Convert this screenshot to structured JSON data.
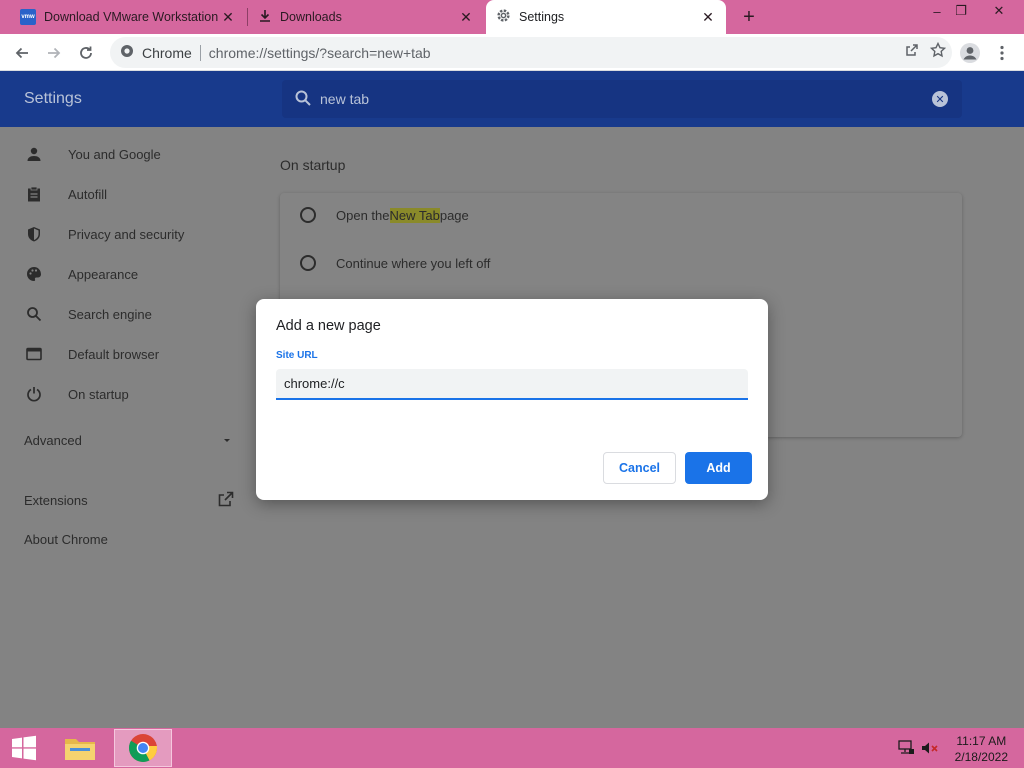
{
  "tabs": [
    {
      "title": "Download VMware Workstation",
      "favicon": "vmware-icon",
      "favicon_text": "vmw"
    },
    {
      "title": "Downloads",
      "favicon": "download-icon"
    },
    {
      "title": "Settings",
      "favicon": "gear-icon",
      "active": true
    }
  ],
  "omnibox": {
    "site": "Chrome",
    "url": "chrome://settings/?search=new+tab"
  },
  "settings": {
    "title": "Settings",
    "search_value": "new tab",
    "nav": [
      {
        "label": "You and Google",
        "icon": "person-icon"
      },
      {
        "label": "Autofill",
        "icon": "clipboard-icon"
      },
      {
        "label": "Privacy and security",
        "icon": "shield-icon"
      },
      {
        "label": "Appearance",
        "icon": "palette-icon"
      },
      {
        "label": "Search engine",
        "icon": "search-icon"
      },
      {
        "label": "Default browser",
        "icon": "browser-icon"
      },
      {
        "label": "On startup",
        "icon": "power-icon"
      }
    ],
    "advanced": "Advanced",
    "extensions": "Extensions",
    "about": "About Chrome",
    "section_title": "On startup",
    "startup_options": {
      "opt1_pre": "Open the ",
      "opt1_hl": "New Tab",
      "opt1_post": " page",
      "opt2": "Continue where you left off"
    }
  },
  "dialog": {
    "title": "Add a new page",
    "field_label": "Site URL",
    "field_value": "chrome://c",
    "cancel": "Cancel",
    "add": "Add"
  },
  "taskbar": {
    "time": "11:17 AM",
    "date": "2/18/2022"
  },
  "colors": {
    "accent": "#1a73e8",
    "tabstrip": "#d5679e",
    "settings_header": "#183a8c"
  }
}
